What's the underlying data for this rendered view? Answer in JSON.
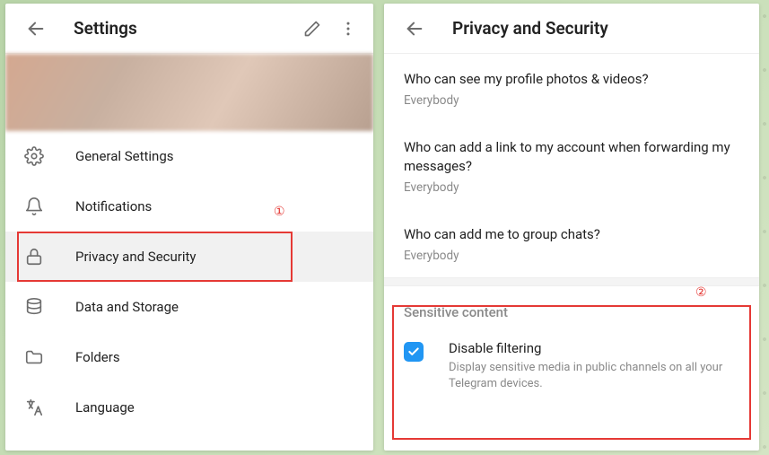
{
  "left": {
    "title": "Settings",
    "menu": [
      {
        "label": "General Settings"
      },
      {
        "label": "Notifications"
      },
      {
        "label": "Privacy and Security"
      },
      {
        "label": "Data and Storage"
      },
      {
        "label": "Folders"
      },
      {
        "label": "Language"
      }
    ]
  },
  "right": {
    "title": "Privacy and Security",
    "rows": [
      {
        "q": "Who can see my profile photos & videos?",
        "a": "Everybody"
      },
      {
        "q": "Who can add a link to my account when forwarding my messages?",
        "a": "Everybody"
      },
      {
        "q": "Who can add me to group chats?",
        "a": "Everybody"
      }
    ],
    "section": "Sensitive content",
    "check": {
      "label": "Disable filtering",
      "desc": "Display sensitive media in public channels on all your Telegram devices.",
      "checked": true
    }
  },
  "annotations": {
    "one": "①",
    "two": "②"
  }
}
